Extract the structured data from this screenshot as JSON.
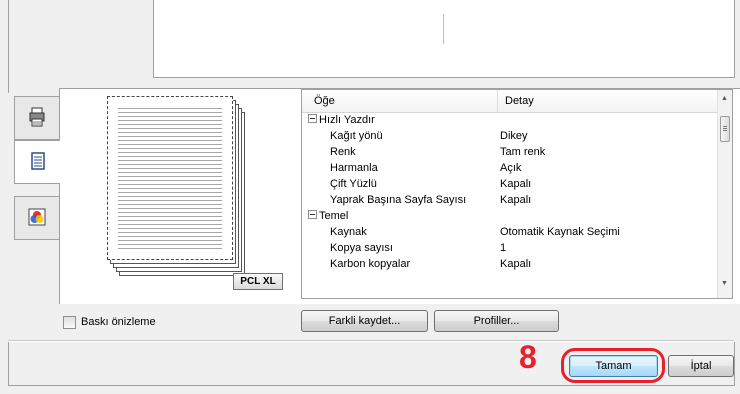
{
  "tabs": [
    {
      "icon": "printer-icon"
    },
    {
      "icon": "document-icon"
    },
    {
      "icon": "color-icon"
    }
  ],
  "preview": {
    "badge": "PCL XL"
  },
  "list": {
    "columns": {
      "item": "Öğe",
      "detail": "Detay"
    },
    "rows": [
      {
        "type": "group",
        "label": "Hızlı Yazdır"
      },
      {
        "type": "item",
        "label": "Kağıt yönü",
        "value": "Dikey"
      },
      {
        "type": "item",
        "label": "Renk",
        "value": "Tam renk"
      },
      {
        "type": "item",
        "label": "Harmanla",
        "value": "Açık"
      },
      {
        "type": "item",
        "label": "Çift Yüzlü",
        "value": "Kapalı"
      },
      {
        "type": "item",
        "label": "Yaprak Başına Sayfa Sayısı",
        "value": "Kapalı"
      },
      {
        "type": "group",
        "label": "Temel"
      },
      {
        "type": "item",
        "label": "Kaynak",
        "value": "Otomatik Kaynak Seçimi"
      },
      {
        "type": "item",
        "label": "Kopya sayısı",
        "value": "1"
      },
      {
        "type": "item",
        "label": "Karbon kopyalar",
        "value": "Kapalı"
      }
    ]
  },
  "controls": {
    "preview_checkbox_label": "Baskı önizleme",
    "save_as_label": "Farkli kaydet...",
    "profiles_label": "Profiller...",
    "ok_label": "Tamam",
    "cancel_label": "İptal"
  },
  "annotation": {
    "step": "8"
  },
  "colors": {
    "highlight": "#e8202a"
  }
}
